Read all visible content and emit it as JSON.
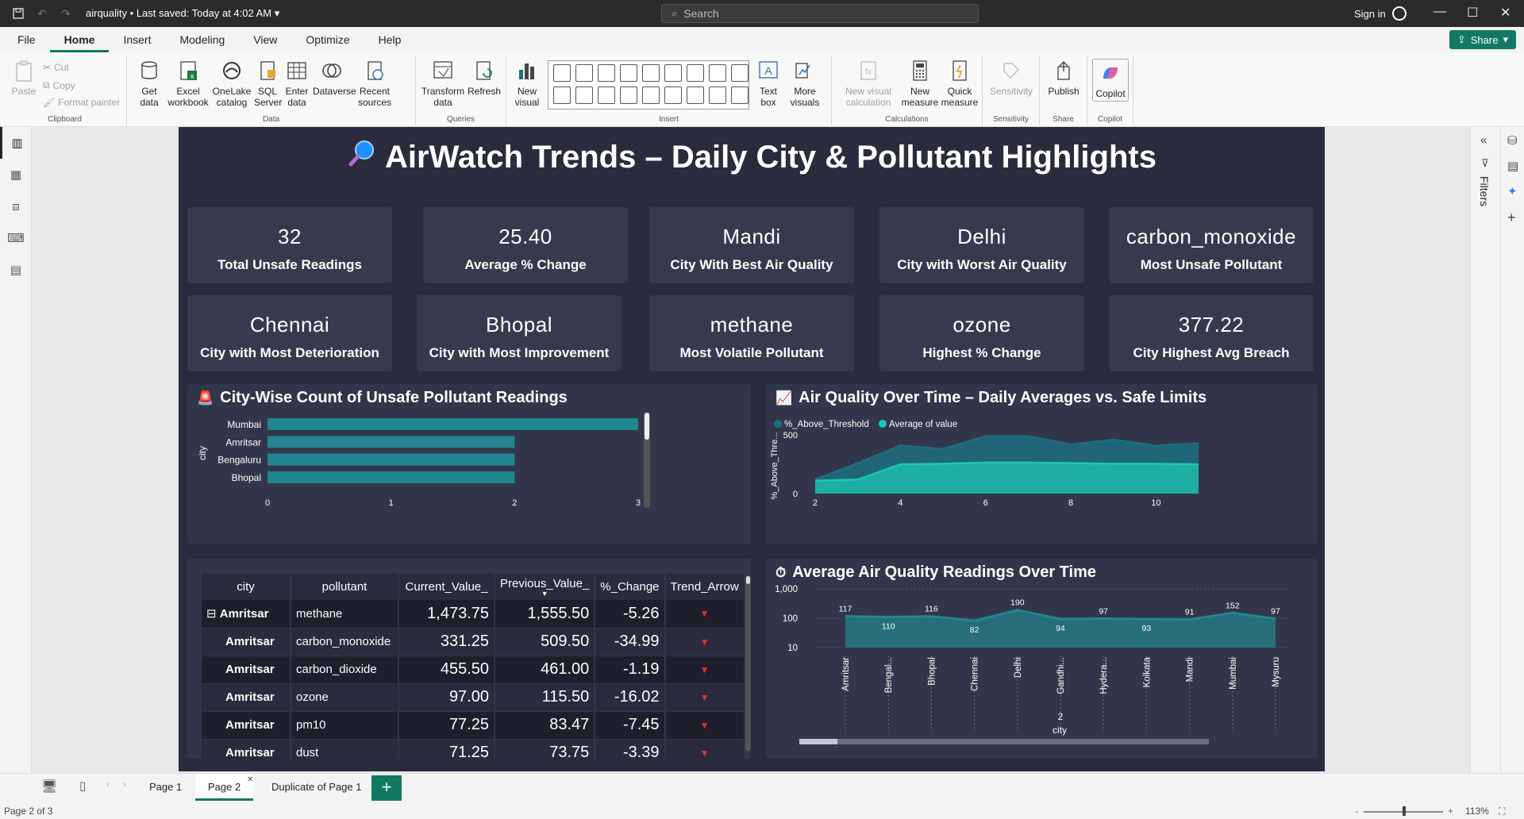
{
  "window": {
    "file_name": "airquality",
    "saved": "• Last saved: Today at 4:02 AM",
    "search_placeholder": "Search",
    "sign_in": "Sign in"
  },
  "menu": [
    "File",
    "Home",
    "Insert",
    "Modeling",
    "View",
    "Optimize",
    "Help"
  ],
  "share_label": "Share",
  "ribbon": {
    "clipboard": {
      "paste": "Paste",
      "cut": "Cut",
      "copy": "Copy",
      "format_painter": "Format painter",
      "group": "Clipboard"
    },
    "data": {
      "get_data": "Get data",
      "excel": "Excel workbook",
      "onelake": "OneLake catalog",
      "sql": "SQL Server",
      "enter": "Enter data",
      "dataverse": "Dataverse",
      "recent": "Recent sources",
      "group": "Data"
    },
    "queries": {
      "transform": "Transform data",
      "refresh": "Refresh",
      "group": "Queries"
    },
    "insert": {
      "new_visual": "New visual",
      "text_box": "Text box",
      "more_visuals": "More visuals",
      "group": "Insert"
    },
    "calculations": {
      "new_visual_calc": "New visual calculation",
      "new_measure": "New measure",
      "quick_measure": "Quick measure",
      "group": "Calculations"
    },
    "sensitivity": {
      "label": "Sensitivity",
      "group": "Sensitivity"
    },
    "share": {
      "publish": "Publish",
      "group": "Share"
    },
    "copilot": {
      "label": "Copilot",
      "group": "Copilot"
    }
  },
  "report": {
    "title": "AirWatch Trends – Daily City & Pollutant Highlights",
    "cards": [
      {
        "value": "32",
        "label": "Total Unsafe Readings"
      },
      {
        "value": "25.40",
        "label": "Average % Change"
      },
      {
        "value": "Mandi",
        "label": "City With Best Air Quality"
      },
      {
        "value": "Delhi",
        "label": "City with Worst Air Quality"
      },
      {
        "value": "carbon_monoxide",
        "label": "Most Unsafe Pollutant"
      },
      {
        "value": "Chennai",
        "label": "City with Most Deterioration"
      },
      {
        "value": "Bhopal",
        "label": "City with Most Improvement"
      },
      {
        "value": "methane",
        "label": "Most Volatile Pollutant"
      },
      {
        "value": "ozone",
        "label": "Highest % Change"
      },
      {
        "value": "377.22",
        "label": "City Highest Avg Breach"
      }
    ],
    "bar_title": "City-Wise Count of Unsafe Pollutant Readings",
    "area_title": "Air Quality Over Time – Daily Averages vs. Safe Limits",
    "line_title": "Average Air Quality Readings Over Time",
    "table": {
      "columns": [
        "city",
        "pollutant",
        "Current_Value_",
        "Previous_Value_",
        "%_Change",
        "Trend_Arrow"
      ],
      "rows": [
        [
          "Amritsar",
          "methane",
          "1,473.75",
          "1,555.50",
          "-5.26"
        ],
        [
          "Amritsar",
          "carbon_monoxide",
          "331.25",
          "509.50",
          "-34.99"
        ],
        [
          "Amritsar",
          "carbon_dioxide",
          "455.50",
          "461.00",
          "-1.19"
        ],
        [
          "Amritsar",
          "ozone",
          "97.00",
          "115.50",
          "-16.02"
        ],
        [
          "Amritsar",
          "pm10",
          "77.25",
          "83.47",
          "-7.45"
        ],
        [
          "Amritsar",
          "dust",
          "71.25",
          "73.75",
          "-3.39"
        ]
      ],
      "arrow": "▼"
    }
  },
  "chart_data": [
    {
      "type": "bar",
      "orientation": "horizontal",
      "title": "City-Wise Count of Unsafe Pollutant Readings",
      "ylabel": "city",
      "categories": [
        "Mumbai",
        "Amritsar",
        "Bengaluru",
        "Bhopal"
      ],
      "values": [
        3,
        2,
        2,
        2
      ],
      "xticks": [
        "0",
        "1",
        "2",
        "3"
      ],
      "xlim": [
        0,
        3
      ],
      "color": "#21868f"
    },
    {
      "type": "area",
      "title": "Air Quality Over Time – Daily Averages vs. Safe Limits",
      "ylabel": "%_Above_Thre...",
      "legend": [
        "%_Above_Threshold",
        "Average of value"
      ],
      "legend_position": "top-left",
      "x": [
        2,
        3,
        4,
        5,
        6,
        7,
        8,
        9,
        10,
        11
      ],
      "series": [
        {
          "name": "%_Above_Threshold",
          "values": [
            120,
            260,
            410,
            380,
            490,
            490,
            420,
            460,
            410,
            430
          ],
          "color": "#1f6e80"
        },
        {
          "name": "Average of value",
          "values": [
            110,
            120,
            250,
            255,
            265,
            265,
            260,
            255,
            255,
            250
          ],
          "color": "#1ec7b3"
        }
      ],
      "xticks": [
        "2",
        "4",
        "6",
        "8",
        "10"
      ],
      "yticks": [
        "0",
        "500"
      ],
      "ylim": [
        0,
        650
      ]
    },
    {
      "type": "line",
      "title": "Average Air Quality Readings Over Time",
      "xlabel": "city",
      "yscale": "log",
      "yticks": [
        "10",
        "100",
        "1,000"
      ],
      "categories": [
        "Amritsar",
        "Bengal...",
        "Bhopal",
        "Chennai",
        "Delhi",
        "Gandhi...",
        "Hydera...",
        "Kolkata",
        "Mandi",
        "Mumbai",
        "Mysuru"
      ],
      "extra_tick_label": "2",
      "values": [
        117,
        110,
        116,
        82,
        190,
        94,
        97,
        93,
        91,
        152,
        97
      ],
      "color": "#21868f"
    }
  ],
  "left_nav": [
    "report-view",
    "table-view",
    "model-view",
    "dax-query-view",
    "tmdl-view"
  ],
  "filters_label": "Filters",
  "pages": {
    "tabs": [
      "Page 1",
      "Page 2",
      "Duplicate of Page 1"
    ],
    "active": "Page 2",
    "status": "Page 2 of 3",
    "zoom": "113%"
  }
}
